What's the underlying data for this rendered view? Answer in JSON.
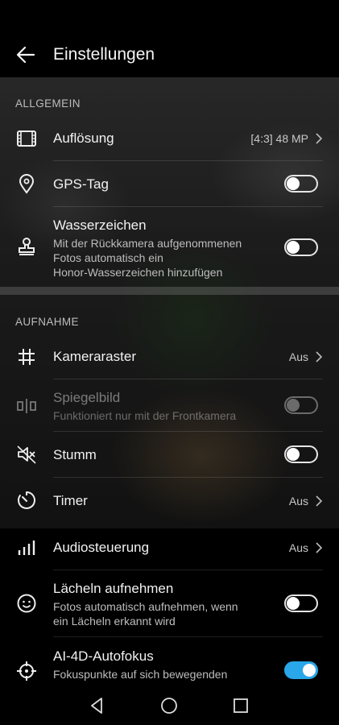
{
  "header": {
    "title": "Einstellungen"
  },
  "sections": {
    "general": "ALLGEMEIN",
    "capture": "AUFNAHME"
  },
  "rows": {
    "resolution": {
      "label": "Auflösung",
      "value": "[4:3] 48 MP"
    },
    "gps": {
      "label": "GPS-Tag",
      "on": false
    },
    "watermark": {
      "label": "Wasserzeichen",
      "sub1": "Mit der Rückkamera aufgenommenen",
      "sub2": "Fotos automatisch ein",
      "sub3": "Honor-Wasserzeichen hinzufügen",
      "on": false
    },
    "grid": {
      "label": "Kameraraster",
      "value": "Aus"
    },
    "mirror": {
      "label": "Spiegelbild",
      "sub1": "Funktioniert nur mit der Frontkamera",
      "enabled": false
    },
    "mute": {
      "label": "Stumm",
      "on": false
    },
    "timer": {
      "label": "Timer",
      "value": "Aus"
    },
    "audio": {
      "label": "Audiosteuerung",
      "value": "Aus"
    },
    "smile": {
      "label": "Lächeln aufnehmen",
      "sub1": "Fotos automatisch aufnehmen, wenn",
      "sub2": "ein Lächeln erkannt wird",
      "on": false
    },
    "af": {
      "label": "AI-4D-Autofokus",
      "sub1": "Fokuspunkte auf sich bewegenden",
      "on": true
    }
  },
  "colors": {
    "accent": "#2aa7e8",
    "background": "#000000"
  },
  "icons": {
    "back": "arrow-left-icon",
    "resolution": "film-frame-icon",
    "gps": "location-pin-icon",
    "watermark": "stamp-icon",
    "grid": "hash-grid-icon",
    "mirror": "mirror-icon",
    "mute": "speaker-mute-icon",
    "timer": "timer-icon",
    "audio": "signal-bars-icon",
    "smile": "smiley-icon",
    "af": "crosshair-icon"
  },
  "navbar": [
    "back-triangle-icon",
    "home-circle-icon",
    "recents-square-icon"
  ]
}
